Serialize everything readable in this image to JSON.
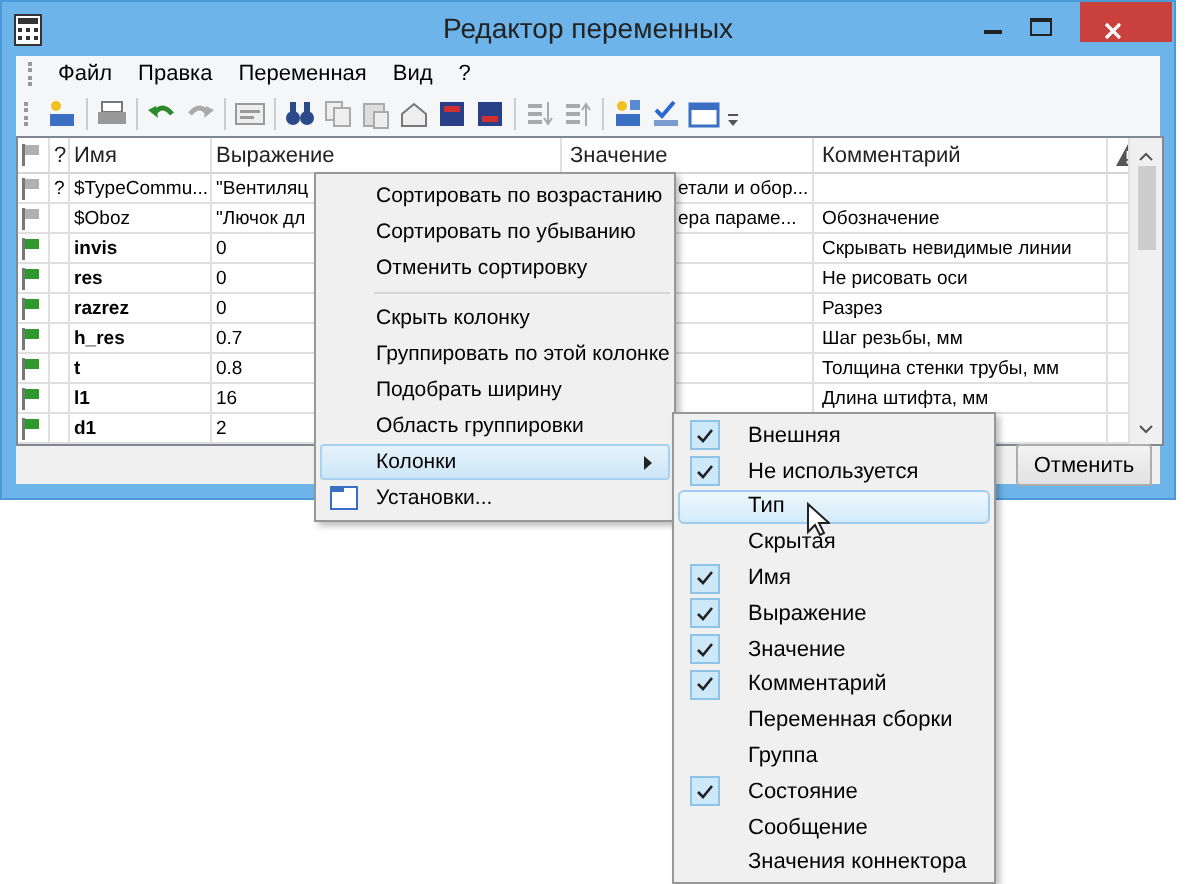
{
  "window": {
    "title": "Редактор переменных"
  },
  "menu_bar": [
    {
      "label": "Файл"
    },
    {
      "label": "Правка"
    },
    {
      "label": "Переменная"
    },
    {
      "label": "Вид"
    },
    {
      "label": "?"
    }
  ],
  "table": {
    "columns": [
      {
        "kind": "flag"
      },
      {
        "kind": "text",
        "label": "?"
      },
      {
        "kind": "text",
        "label": "Имя"
      },
      {
        "kind": "text",
        "label": "Выражение"
      },
      {
        "kind": "text",
        "label": "Значение"
      },
      {
        "kind": "text",
        "label": "Комментарий"
      },
      {
        "kind": "warning"
      }
    ],
    "rows": [
      {
        "kind": "system",
        "mark": "?",
        "name": "$TypeCommu...",
        "expression": "\"Вентиляц",
        "value": "етали и обор...",
        "comment": ""
      },
      {
        "kind": "system",
        "mark": "",
        "name": "$Oboz",
        "expression": "\"Лючок дл",
        "value": "ера параме...",
        "comment": "Обозначение"
      },
      {
        "kind": "user",
        "mark": "",
        "name": "invis",
        "expression": "0",
        "value": "",
        "comment": "Скрывать невидимые линии"
      },
      {
        "kind": "user",
        "mark": "",
        "name": "res",
        "expression": "0",
        "value": "",
        "comment": "Не рисовать оси"
      },
      {
        "kind": "user",
        "mark": "",
        "name": "razrez",
        "expression": "0",
        "value": "",
        "comment": "Разрез"
      },
      {
        "kind": "user",
        "mark": "",
        "name": "h_res",
        "expression": "0.7",
        "value": "",
        "comment": "Шаг резьбы, мм"
      },
      {
        "kind": "user",
        "mark": "",
        "name": "t",
        "expression": "0.8",
        "value": "",
        "comment": "Толщина стенки трубы, мм"
      },
      {
        "kind": "user",
        "mark": "",
        "name": "l1",
        "expression": "16",
        "value": "",
        "comment": "Длина штифта, мм"
      },
      {
        "kind": "user",
        "mark": "",
        "name": "d1",
        "expression": "2",
        "value": "",
        "comment": ""
      }
    ]
  },
  "buttons": [
    {
      "label": "Отменить"
    }
  ],
  "context_menu": {
    "items": [
      {
        "kind": "item",
        "label": "Сортировать по возрастанию",
        "selected": false
      },
      {
        "kind": "item",
        "label": "Сортировать по убыванию",
        "selected": false
      },
      {
        "kind": "item",
        "label": "Отменить сортировку",
        "selected": false
      },
      {
        "kind": "separator"
      },
      {
        "kind": "item",
        "label": "Скрыть колонку",
        "selected": false
      },
      {
        "kind": "item",
        "label": "Группировать по этой колонке",
        "selected": false
      },
      {
        "kind": "item",
        "label": "Подобрать ширину",
        "selected": false
      },
      {
        "kind": "item",
        "label": "Область группировки",
        "selected": false
      },
      {
        "kind": "submenu",
        "label": "Колонки",
        "selected": true
      },
      {
        "kind": "settings",
        "label": "Установки...",
        "selected": false
      }
    ]
  },
  "columns_submenu": [
    {
      "label": "Внешняя",
      "checked": true,
      "selected": false
    },
    {
      "label": "Не используется",
      "checked": true,
      "selected": false
    },
    {
      "label": "Тип",
      "checked": false,
      "selected": true
    },
    {
      "label": "Скрытая",
      "checked": false,
      "selected": false
    },
    {
      "label": "Имя",
      "checked": true,
      "selected": false
    },
    {
      "label": "Выражение",
      "checked": true,
      "selected": false
    },
    {
      "label": "Значение",
      "checked": true,
      "selected": false
    },
    {
      "label": "Комментарий",
      "checked": true,
      "selected": false
    },
    {
      "label": "Переменная сборки",
      "checked": false,
      "selected": false
    },
    {
      "label": "Группа",
      "checked": false,
      "selected": false
    },
    {
      "label": "Состояние",
      "checked": true,
      "selected": false
    },
    {
      "label": "Сообщение",
      "checked": false,
      "selected": false
    },
    {
      "label": "Значения коннектора",
      "checked": false,
      "selected": false
    }
  ]
}
